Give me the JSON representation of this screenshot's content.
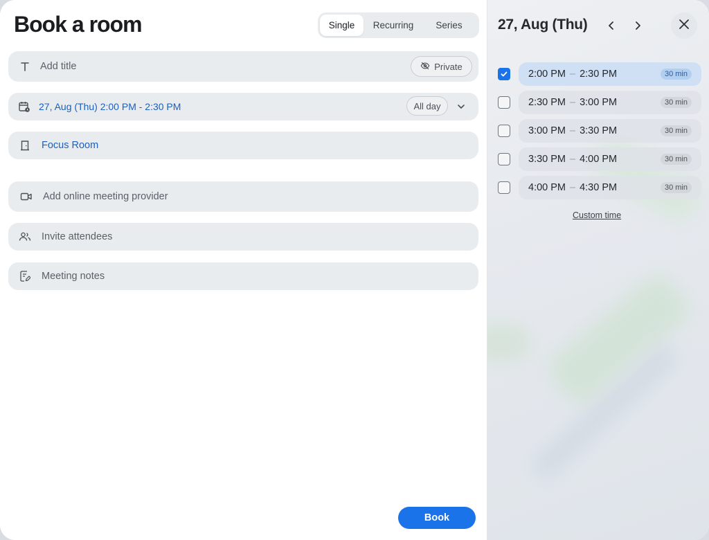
{
  "header": {
    "title": "Book a room",
    "tabs": [
      {
        "label": "Single",
        "active": true
      },
      {
        "label": "Recurring",
        "active": false
      },
      {
        "label": "Series",
        "active": false
      }
    ]
  },
  "form": {
    "title_placeholder": "Add title",
    "private_label": "Private",
    "date_value": "27, Aug (Thu) 2:00 PM - 2:30 PM",
    "allday_label": "All day",
    "room_value": "Focus Room",
    "meeting_placeholder": "Add online meeting provider",
    "attendees_placeholder": "Invite attendees",
    "notes_placeholder": "Meeting notes"
  },
  "footer": {
    "book_label": "Book"
  },
  "schedule": {
    "date_heading": "27, Aug (Thu)",
    "slots": [
      {
        "start": "2:00 PM",
        "end": "2:30 PM",
        "duration": "30 min",
        "checked": true
      },
      {
        "start": "2:30 PM",
        "end": "3:00 PM",
        "duration": "30 min",
        "checked": false
      },
      {
        "start": "3:00 PM",
        "end": "3:30 PM",
        "duration": "30 min",
        "checked": false
      },
      {
        "start": "3:30 PM",
        "end": "4:00 PM",
        "duration": "30 min",
        "checked": false
      },
      {
        "start": "4:00 PM",
        "end": "4:30 PM",
        "duration": "30 min",
        "checked": false
      }
    ],
    "separator": "–",
    "custom_time_label": "Custom time"
  },
  "colors": {
    "accent": "#1a73e8",
    "link_text": "#1b5fbf",
    "field_bg": "#e9ecef",
    "selected_slot_bg": "#cfe0f5"
  },
  "icons": [
    "text-icon",
    "eye-off-icon",
    "calendar-clock-icon",
    "chevron-down-icon",
    "door-icon",
    "video-icon",
    "people-icon",
    "note-edit-icon",
    "chevron-left-icon",
    "chevron-right-icon",
    "close-icon",
    "check-icon"
  ]
}
